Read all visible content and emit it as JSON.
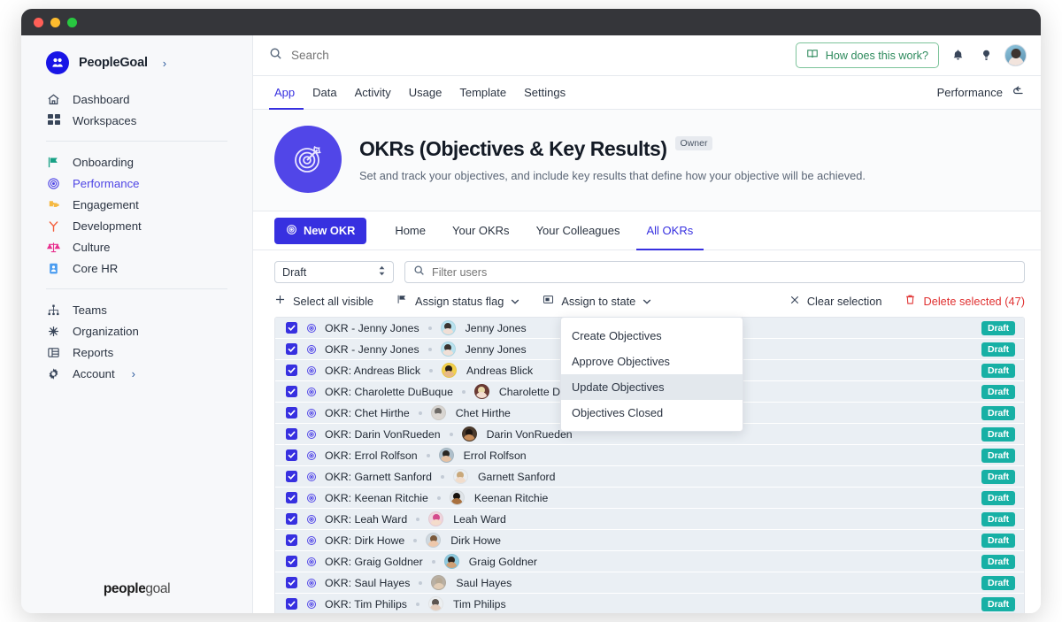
{
  "window": {
    "controls": [
      "close",
      "minimize",
      "maximize"
    ]
  },
  "sidebar": {
    "brand": {
      "name": "PeopleGoal",
      "chevron": "›"
    },
    "group1": [
      {
        "label": "Dashboard",
        "icon": "home-icon"
      },
      {
        "label": "Workspaces",
        "icon": "grid-icon"
      }
    ],
    "group2": [
      {
        "label": "Onboarding",
        "icon": "flag-icon",
        "color": "#16a085"
      },
      {
        "label": "Performance",
        "icon": "target-icon",
        "color": "#4f46e5",
        "active": true
      },
      {
        "label": "Engagement",
        "icon": "puzzle-icon",
        "color": "#f5b942"
      },
      {
        "label": "Development",
        "icon": "sprout-icon",
        "color": "#f4603e"
      },
      {
        "label": "Culture",
        "icon": "scales-icon",
        "color": "#e8318f"
      },
      {
        "label": "Core HR",
        "icon": "badge-id-icon",
        "color": "#4a9cf0"
      }
    ],
    "group3": [
      {
        "label": "Teams",
        "icon": "org-tree-icon"
      },
      {
        "label": "Organization",
        "icon": "network-icon"
      },
      {
        "label": "Reports",
        "icon": "table-icon"
      },
      {
        "label": "Account",
        "icon": "gear-icon",
        "chevron": "›"
      }
    ],
    "footer": {
      "bold": "people",
      "light": "goal"
    }
  },
  "topbar": {
    "search_placeholder": "Search",
    "help_button": "How does this work?",
    "icons": [
      "search-icon",
      "book-icon",
      "bell-icon",
      "lightbulb-icon",
      "avatar"
    ]
  },
  "nav_tabs": {
    "items": [
      {
        "label": "App",
        "active": true
      },
      {
        "label": "Data",
        "active": false
      },
      {
        "label": "Activity",
        "active": false
      },
      {
        "label": "Usage",
        "active": false
      },
      {
        "label": "Template",
        "active": false
      },
      {
        "label": "Settings",
        "active": false
      }
    ],
    "right_label": "Performance",
    "right_icon": "back-arrow-icon"
  },
  "app_header": {
    "icon": "target-arrow-icon",
    "title": "OKRs (Objectives & Key Results)",
    "badge": "Owner",
    "description": "Set and track your objectives, and include key results that define how your objective will be achieved.",
    "icon_color": "#5146e8"
  },
  "action_tabs": {
    "new_button": {
      "label": "New OKR",
      "icon": "target-icon"
    },
    "items": [
      {
        "label": "Home",
        "active": false
      },
      {
        "label": "Your OKRs",
        "active": false
      },
      {
        "label": "Your Colleagues",
        "active": false
      },
      {
        "label": "All OKRs",
        "active": true
      }
    ]
  },
  "toolbar": {
    "state_select": {
      "value": "Draft",
      "icon": "updown-chevron-icon"
    },
    "filter": {
      "placeholder": "Filter users",
      "value": "",
      "icon": "search-icon"
    },
    "select_all": {
      "label": "Select all visible",
      "icon": "plus-icon"
    },
    "assign_flag": {
      "label": "Assign status flag",
      "icon": "flag-icon",
      "chevron": "chevron-down-icon"
    },
    "assign_state": {
      "label": "Assign to state",
      "icon": "state-box-icon",
      "chevron": "chevron-down-icon"
    },
    "clear_selection": {
      "label": "Clear selection",
      "icon": "close-icon"
    },
    "delete_selected": {
      "label": "Delete selected (47)",
      "icon": "trash-icon",
      "color": "#e03131"
    }
  },
  "dropdown": {
    "items": [
      {
        "label": "Create Objectives",
        "highlighted": false
      },
      {
        "label": "Approve Objectives",
        "highlighted": false
      },
      {
        "label": "Update Objectives",
        "highlighted": true
      },
      {
        "label": "Objectives Closed",
        "highlighted": false
      }
    ]
  },
  "list": {
    "badge_color": "#17b0a5",
    "rows": [
      {
        "title": "OKR - Jenny Jones",
        "person": "Jenny Jones",
        "badge": "Draft",
        "checked": true,
        "hair": "#3a3430",
        "skin": "#f0dfd6",
        "bg": "#b8e2ef"
      },
      {
        "title": "OKR - Jenny Jones",
        "person": "Jenny Jones",
        "badge": "Draft",
        "checked": true,
        "hair": "#3a3430",
        "skin": "#f0dfd6",
        "bg": "#b8e2ef"
      },
      {
        "title": "OKR: Andreas Blick",
        "person": "Andreas Blick",
        "badge": "Draft",
        "checked": true,
        "hair": "#241c16",
        "skin": "#e8b887",
        "bg": "#f2d04b"
      },
      {
        "title": "OKR: Charolette DuBuque",
        "person": "Charolette DuBuque",
        "badge": "Draft",
        "checked": true,
        "hair": "#e8d9a8",
        "skin": "#f3ddd0",
        "bg": "#6b3a34"
      },
      {
        "title": "OKR: Chet Hirthe",
        "person": "Chet Hirthe",
        "badge": "Draft",
        "checked": true,
        "hair": "#6d6a66",
        "skin": "#dcd7d2",
        "bg": "#d8d5d1"
      },
      {
        "title": "OKR: Darin VonRueden",
        "person": "Darin VonRueden",
        "badge": "Draft",
        "checked": true,
        "hair": "#1d1510",
        "skin": "#c78c59",
        "bg": "#4b3a2c"
      },
      {
        "title": "OKR: Errol Rolfson",
        "person": "Errol Rolfson",
        "badge": "Draft",
        "checked": true,
        "hair": "#2a2722",
        "skin": "#e5c2a4",
        "bg": "#aebfcb"
      },
      {
        "title": "OKR: Garnett Sanford",
        "person": "Garnett Sanford",
        "badge": "Draft",
        "checked": true,
        "hair": "#c9a87a",
        "skin": "#f1ddcc",
        "bg": "#e9eef2"
      },
      {
        "title": "OKR: Keenan Ritchie",
        "person": "Keenan Ritchie",
        "badge": "Draft",
        "checked": true,
        "hair": "#17120e",
        "skin": "#a9713f",
        "bg": "#dfe4e8"
      },
      {
        "title": "OKR: Leah Ward",
        "person": "Leah Ward",
        "badge": "Draft",
        "checked": true,
        "hair": "#d44a8c",
        "skin": "#f4dccb",
        "bg": "#efd4dd"
      },
      {
        "title": "OKR: Dirk Howe",
        "person": "Dirk Howe",
        "badge": "Draft",
        "checked": true,
        "hair": "#7b5a3c",
        "skin": "#eec8ab",
        "bg": "#cfd9e0"
      },
      {
        "title": "OKR: Graig Goldner",
        "person": "Graig Goldner",
        "badge": "Draft",
        "checked": true,
        "hair": "#2b2520",
        "skin": "#cfa177",
        "bg": "#8fcbe0"
      },
      {
        "title": "OKR: Saul Hayes",
        "person": "Saul Hayes",
        "badge": "Draft",
        "checked": true,
        "hair": "#b7a995",
        "skin": "#e2cdb6",
        "bg": "#b9b0a4"
      },
      {
        "title": "OKR: Tim Philips",
        "person": "Tim Philips",
        "badge": "Draft",
        "checked": true,
        "hair": "#5d5550",
        "skin": "#e4cdbd",
        "bg": "#eceff1"
      }
    ]
  }
}
